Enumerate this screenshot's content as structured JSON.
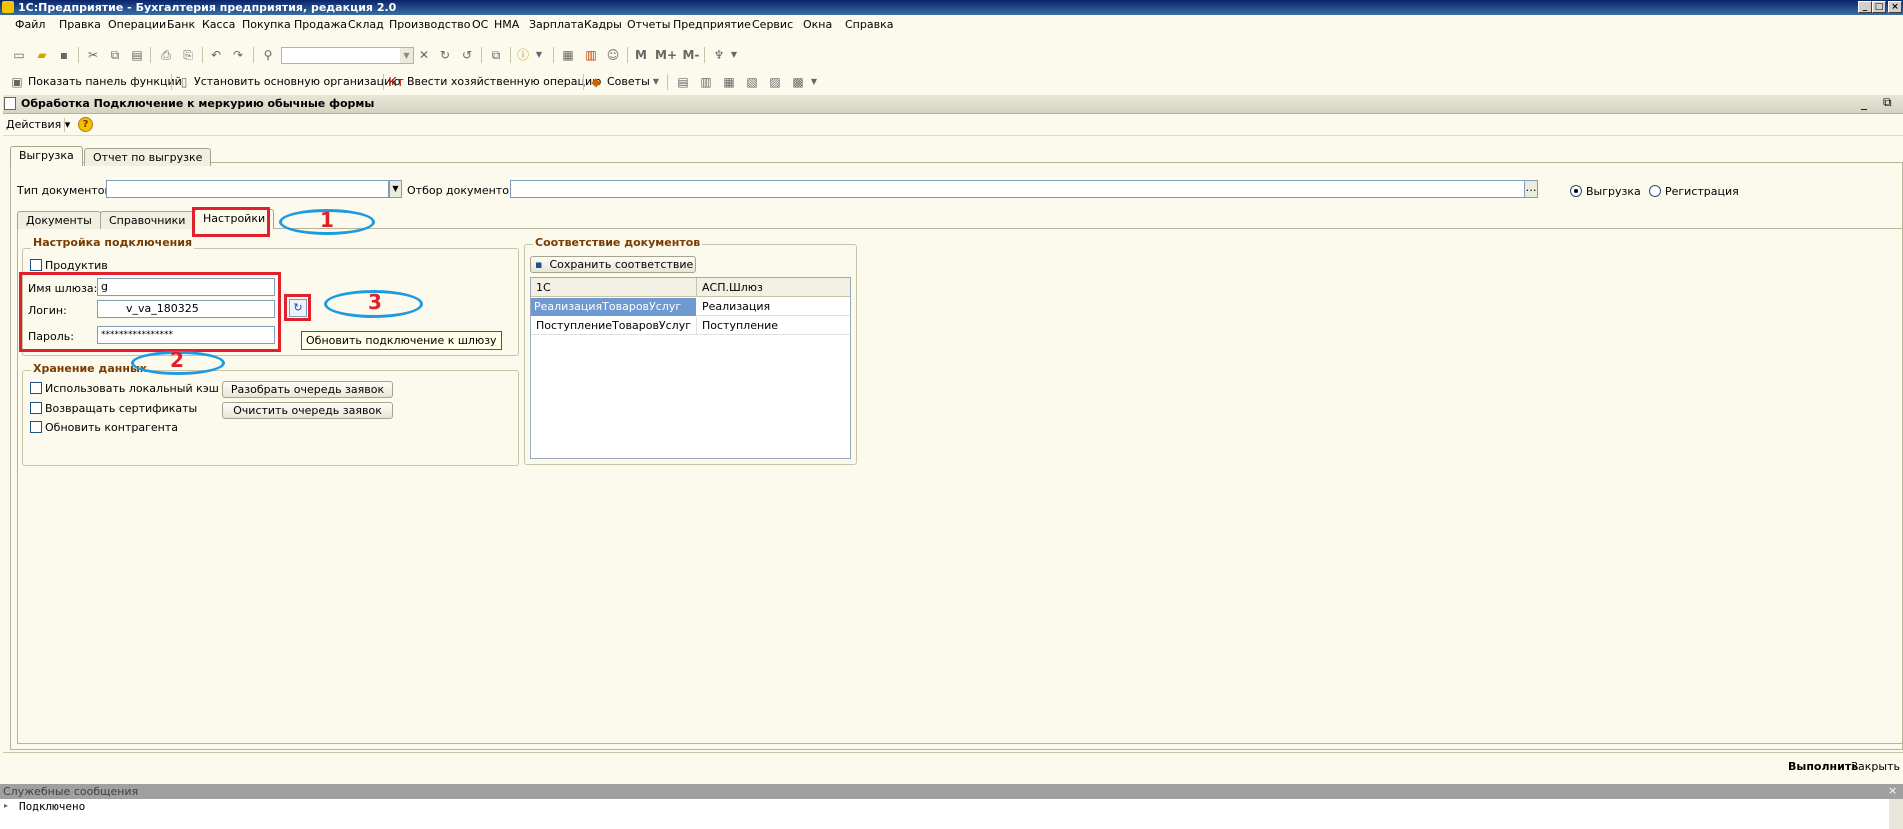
{
  "window": {
    "title": "1С:Предприятие - Бухгалтерия предприятия, редакция 2.0"
  },
  "menu": [
    "Файл",
    "Правка",
    "Операции",
    "Банк",
    "Касса",
    "Покупка",
    "Продажа",
    "Склад",
    "Производство",
    "ОС",
    "НМА",
    "Зарплата",
    "Кадры",
    "Отчеты",
    "Предприятие",
    "Сервис",
    "Окна",
    "Справка"
  ],
  "toolbar2": {
    "show_panel": "Показать панель функций",
    "set_org": "Установить основную организацию",
    "enter_op": "Ввести хозяйственную операцию",
    "tips": "Советы"
  },
  "form": {
    "title": "Обработка  Подключение к меркурию обычные формы",
    "actions_label": "Действия",
    "help_icon_label": "?",
    "top_tabs": [
      "Выгрузка",
      "Отчет по выгрузке"
    ],
    "doc_type_label": "Тип документов:",
    "doc_type_value": "",
    "doc_filter_label": "Отбор документов:",
    "doc_filter_value": "",
    "radio_unload": "Выгрузка",
    "radio_registration": "Регистрация",
    "radio_selected": "Выгрузка",
    "inner_tabs": [
      "Документы",
      "Справочники",
      "Настройки"
    ],
    "active_inner_tab": "Настройки",
    "conn": {
      "title": "Настройка подключения",
      "production_label": "Продуктив",
      "production_checked": false,
      "gateway_label": "Имя шлюза:",
      "gateway_value": "g",
      "login_label": "Логин:",
      "login_value": "v_va_180325",
      "password_label": "Пароль:",
      "password_value": "****************",
      "refresh_tooltip": "Обновить подключение к шлюзу"
    },
    "storage": {
      "title": "Хранение данных",
      "local_cache": "Использовать локальный кэш",
      "return_certs": "Возвращать сертификаты",
      "update_contractor": "Обновить контрагента",
      "parse_queue_btn": "Разобрать очередь заявок",
      "clear_queue_btn": "Очистить очередь заявок"
    },
    "mapping": {
      "title": "Соответствие документов",
      "save_btn": "Сохранить соответствие",
      "columns": [
        "1С",
        "АСП.Шлюз"
      ],
      "rows": [
        [
          "РеализацияТоваровУслуг",
          "Реализация"
        ],
        [
          "ПоступлениеТоваровУслуг",
          "Поступление"
        ]
      ]
    },
    "execute_btn": "Выполнить",
    "close_btn": "Закрыть"
  },
  "annotations": {
    "n1": "1",
    "n2": "2",
    "n3": "3"
  },
  "messages": {
    "title": "Служебные сообщения",
    "line": "Подключено"
  }
}
